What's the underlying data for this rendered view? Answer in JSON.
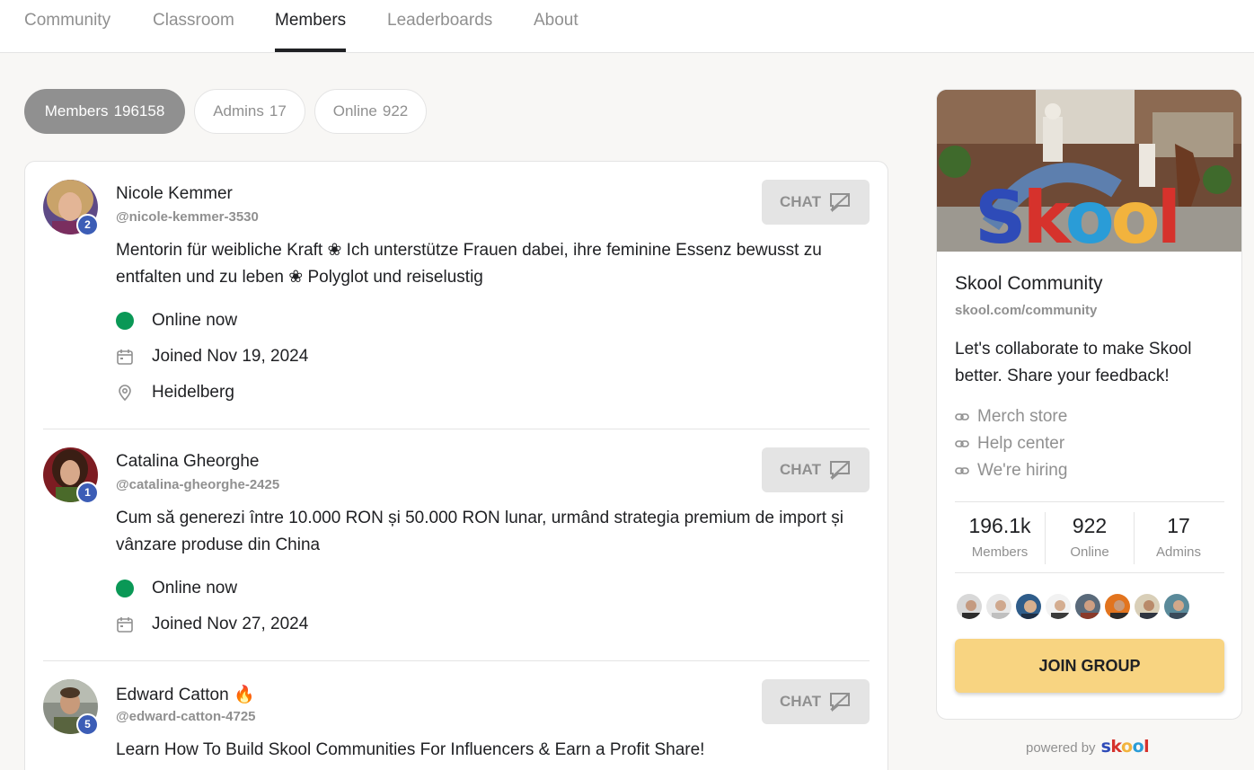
{
  "nav": {
    "tabs": [
      "Community",
      "Classroom",
      "Members",
      "Leaderboards",
      "About"
    ]
  },
  "filters": [
    {
      "label": "Members",
      "count": "196158"
    },
    {
      "label": "Admins",
      "count": "17"
    },
    {
      "label": "Online",
      "count": "922"
    }
  ],
  "members": [
    {
      "name": "Nicole Kemmer",
      "handle": "@nicole-kemmer-3530",
      "level": "2",
      "bio": "Mentorin für weibliche Kraft ❀ Ich unterstütze Frauen dabei, ihre feminine Essenz bewusst zu entfalten und zu leben ❀ Polyglot und reiselustig",
      "status": "Online now",
      "joined": "Joined Nov 19, 2024",
      "location": "Heidelberg",
      "chat_label": "CHAT"
    },
    {
      "name": "Catalina Gheorghe",
      "handle": "@catalina-gheorghe-2425",
      "level": "1",
      "bio": "Cum să generezi între 10.000 RON și 50.000 RON lunar, urmând strategia premium de import și vânzare produse din China",
      "status": "Online now",
      "joined": "Joined Nov 27, 2024",
      "chat_label": "CHAT"
    },
    {
      "name": "Edward Catton 🔥",
      "handle": "@edward-catton-4725",
      "level": "5",
      "bio": "Learn How To Build Skool Communities For Influencers & Earn a Profit Share!",
      "chat_label": "CHAT"
    }
  ],
  "group": {
    "cover_lettering": "Skool",
    "name": "Skool Community",
    "url": "skool.com/community",
    "description": "Let's collaborate to make Skool better. Share your feedback!",
    "links": [
      "Merch store",
      "Help center",
      "We're hiring"
    ],
    "stats": [
      {
        "value": "196.1k",
        "label": "Members"
      },
      {
        "value": "922",
        "label": "Online"
      },
      {
        "value": "17",
        "label": "Admins"
      }
    ],
    "join_label": "JOIN GROUP"
  },
  "footer": {
    "powered_by": "powered by",
    "logo_text": "skool",
    "logo_colors": [
      "#2e4bb8",
      "#d6322c",
      "#f2b33d",
      "#2a9cd7",
      "#d6322c"
    ]
  },
  "colors": {
    "online": "#0a9856",
    "level_badge": "#3c5db6",
    "join_button": "#f8d481",
    "muted_text": "#909090"
  },
  "icons": [
    "calendar-icon",
    "location-pin-icon",
    "chat-bubble-icon",
    "link-icon"
  ]
}
